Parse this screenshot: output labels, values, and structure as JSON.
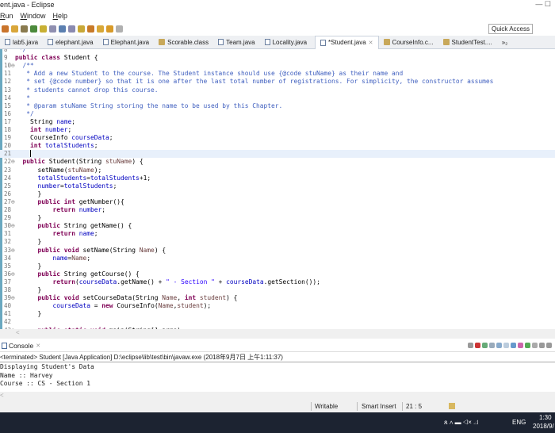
{
  "window": {
    "title": "ent.java - Eclipse",
    "controls": "—  ☐"
  },
  "menu": [
    {
      "label": "Run",
      "u": "R",
      "rest": "un"
    },
    {
      "label": "Window",
      "u": "W",
      "rest": "indow"
    },
    {
      "label": "Help",
      "u": "H",
      "rest": "elp"
    }
  ],
  "toolbar": {
    "quick_access": "Quick Access",
    "colors": [
      "#c9742c",
      "#d9a63a",
      "#8a7b4f",
      "#4c8a3c",
      "#c8b034",
      "#8f8fb0",
      "#5b7fb0",
      "#8a8ab0",
      "#c8a838",
      "#c87a28",
      "#d8a838",
      "#d89a28",
      "#b0b0b0"
    ]
  },
  "tabs": [
    {
      "label": "lab5.java",
      "icon": "java-file"
    },
    {
      "label": "elephant.java",
      "icon": "java-file"
    },
    {
      "label": "Elephant.java",
      "icon": "java-file"
    },
    {
      "label": "Scorable.class",
      "icon": "class-file"
    },
    {
      "label": "Team.java",
      "icon": "java-file"
    },
    {
      "label": "Locality.java",
      "icon": "java-file"
    },
    {
      "label": "*Student.java",
      "icon": "java-file",
      "active": true,
      "close": "✕"
    },
    {
      "label": "CourseInfo.c...",
      "icon": "class-file"
    },
    {
      "label": "StudentTest....",
      "icon": "class-file"
    },
    {
      "label": "»₂",
      "icon": "overflow"
    }
  ],
  "editor": {
    "lines": [
      {
        "n": "8",
        "t": [
          [
            " */",
            "comment"
          ]
        ]
      },
      {
        "n": "9",
        "t": [
          [
            "public class ",
            "kw"
          ],
          [
            "Student {",
            "plain"
          ]
        ]
      },
      {
        "n": "10⊖",
        "t": [
          [
            "  /**",
            "comment"
          ]
        ]
      },
      {
        "n": "11",
        "t": [
          [
            "   * Add a new Student to the course. The Student instance should use {@code stuName} as their name and",
            "comment"
          ]
        ]
      },
      {
        "n": "12",
        "t": [
          [
            "   * set {@code number} so that it is one after the last total number of registrations. For simplicity, the constructor assumes",
            "comment"
          ]
        ]
      },
      {
        "n": "13",
        "t": [
          [
            "   * students cannot drop this course.",
            "comment"
          ]
        ]
      },
      {
        "n": "14",
        "t": [
          [
            "   *",
            "comment"
          ]
        ]
      },
      {
        "n": "15",
        "t": [
          [
            "   * @param stuName String storing the name to be used by this Chapter.",
            "comment"
          ]
        ]
      },
      {
        "n": "16",
        "t": [
          [
            "   */",
            "comment"
          ]
        ]
      },
      {
        "n": "17",
        "t": [
          [
            "    String ",
            "plain"
          ],
          [
            "name",
            "field"
          ],
          [
            ";",
            "plain"
          ]
        ]
      },
      {
        "n": "18",
        "t": [
          [
            "    ",
            "plain"
          ],
          [
            "int ",
            "kw"
          ],
          [
            "number",
            "field"
          ],
          [
            ";",
            "plain"
          ]
        ]
      },
      {
        "n": "19",
        "t": [
          [
            "    CourseInfo ",
            "plain"
          ],
          [
            "courseData",
            "field"
          ],
          [
            ";",
            "plain"
          ]
        ]
      },
      {
        "n": "20",
        "t": [
          [
            "    ",
            "plain"
          ],
          [
            "int ",
            "kw"
          ],
          [
            "totalStudents",
            "field"
          ],
          [
            ";",
            "plain"
          ]
        ]
      },
      {
        "n": "21",
        "t": [
          [
            "    ",
            "plain"
          ]
        ],
        "cursor": true
      },
      {
        "n": "22⊖",
        "t": [
          [
            "  ",
            "plain"
          ],
          [
            "public ",
            "kw"
          ],
          [
            "Student(String ",
            "plain"
          ],
          [
            "stuName",
            "param"
          ],
          [
            ") {",
            "plain"
          ]
        ]
      },
      {
        "n": "23",
        "t": [
          [
            "      setName(",
            "plain"
          ],
          [
            "stuName",
            "param"
          ],
          [
            ");",
            "plain"
          ]
        ]
      },
      {
        "n": "24",
        "t": [
          [
            "      ",
            "plain"
          ],
          [
            "totalStudents",
            "field"
          ],
          [
            "=",
            "plain"
          ],
          [
            "totalStudents",
            "field"
          ],
          [
            "+1;",
            "plain"
          ]
        ]
      },
      {
        "n": "25",
        "t": [
          [
            "      ",
            "plain"
          ],
          [
            "number",
            "field"
          ],
          [
            "=",
            "plain"
          ],
          [
            "totalStudents",
            "field"
          ],
          [
            ";",
            "plain"
          ]
        ]
      },
      {
        "n": "26",
        "t": [
          [
            "      }",
            "plain"
          ]
        ]
      },
      {
        "n": "27⊖",
        "t": [
          [
            "      ",
            "plain"
          ],
          [
            "public int ",
            "kw"
          ],
          [
            "getNumber(){",
            "plain"
          ]
        ]
      },
      {
        "n": "28",
        "t": [
          [
            "          ",
            "plain"
          ],
          [
            "return ",
            "kw"
          ],
          [
            "number",
            "field"
          ],
          [
            ";",
            "plain"
          ]
        ]
      },
      {
        "n": "29",
        "t": [
          [
            "      }",
            "plain"
          ]
        ]
      },
      {
        "n": "30⊖",
        "t": [
          [
            "      ",
            "plain"
          ],
          [
            "public ",
            "kw"
          ],
          [
            "String getName() {",
            "plain"
          ]
        ]
      },
      {
        "n": "31",
        "t": [
          [
            "          ",
            "plain"
          ],
          [
            "return ",
            "kw"
          ],
          [
            "name",
            "field"
          ],
          [
            ";",
            "plain"
          ]
        ]
      },
      {
        "n": "32",
        "t": [
          [
            "      }",
            "plain"
          ]
        ]
      },
      {
        "n": "33⊖",
        "t": [
          [
            "      ",
            "plain"
          ],
          [
            "public void ",
            "kw"
          ],
          [
            "setName(String ",
            "plain"
          ],
          [
            "Name",
            "param"
          ],
          [
            ") {",
            "plain"
          ]
        ]
      },
      {
        "n": "34",
        "t": [
          [
            "          ",
            "plain"
          ],
          [
            "name",
            "field"
          ],
          [
            "=",
            "plain"
          ],
          [
            "Name",
            "param"
          ],
          [
            ";",
            "plain"
          ]
        ]
      },
      {
        "n": "35",
        "t": [
          [
            "      }",
            "plain"
          ]
        ]
      },
      {
        "n": "36⊖",
        "t": [
          [
            "      ",
            "plain"
          ],
          [
            "public ",
            "kw"
          ],
          [
            "String getCourse() {",
            "plain"
          ]
        ]
      },
      {
        "n": "37",
        "t": [
          [
            "          ",
            "plain"
          ],
          [
            "return",
            "kw"
          ],
          [
            "(",
            "plain"
          ],
          [
            "courseData",
            "field"
          ],
          [
            ".getName() + ",
            "plain"
          ],
          [
            "\" - Section \"",
            "str"
          ],
          [
            " + ",
            "plain"
          ],
          [
            "courseData",
            "field"
          ],
          [
            ".getSection());",
            "plain"
          ]
        ]
      },
      {
        "n": "38",
        "t": [
          [
            "      }",
            "plain"
          ]
        ]
      },
      {
        "n": "39⊖",
        "t": [
          [
            "      ",
            "plain"
          ],
          [
            "public void ",
            "kw"
          ],
          [
            "setCourseData(String ",
            "plain"
          ],
          [
            "Name",
            "param"
          ],
          [
            ", ",
            "plain"
          ],
          [
            "int ",
            "kw"
          ],
          [
            "student",
            "param"
          ],
          [
            ") {",
            "plain"
          ]
        ]
      },
      {
        "n": "40",
        "t": [
          [
            "          ",
            "plain"
          ],
          [
            "courseData",
            "field"
          ],
          [
            " = ",
            "plain"
          ],
          [
            "new ",
            "kw"
          ],
          [
            "CourseInfo(",
            "plain"
          ],
          [
            "Name",
            "param"
          ],
          [
            ",",
            "plain"
          ],
          [
            "student",
            "param"
          ],
          [
            ");",
            "plain"
          ]
        ]
      },
      {
        "n": "41",
        "t": [
          [
            "      }",
            "plain"
          ]
        ]
      },
      {
        "n": "42",
        "t": [
          [
            "",
            "plain"
          ]
        ]
      },
      {
        "n": "43⊖",
        "t": [
          [
            "      ",
            "plain"
          ],
          [
            "public static void ",
            "kw"
          ],
          [
            "main(String[] args)",
            "plain"
          ]
        ]
      }
    ]
  },
  "console": {
    "tab": "Console",
    "close": "✕",
    "terminated": "<terminated> Student [Java Application] D:\\eclipse\\lib\\test\\bin\\javaw.exe (2018年9月7日 上午1:11:37)",
    "output": [
      "Displaying Student's Data",
      "Name :: Harvey",
      "Course :: CS - Section 1"
    ]
  },
  "status": {
    "writable": "Writable",
    "insert": "Smart Insert",
    "position": "21 : 5"
  },
  "taskbar": {
    "lang": "ENG",
    "time": "1:30",
    "date": "2018/9/",
    "tray": "ጸ  ∧  ▬  ◁×  ◿"
  }
}
